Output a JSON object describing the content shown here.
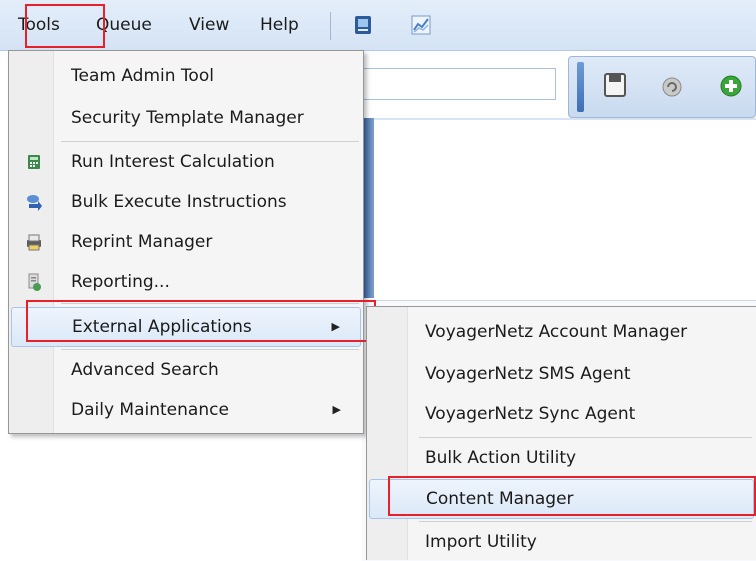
{
  "menubar": {
    "items": [
      {
        "label": "Tools"
      },
      {
        "label": "Queue"
      },
      {
        "label": "View"
      },
      {
        "label": "Help"
      }
    ],
    "icons": [
      "report-icon",
      "chart-icon"
    ]
  },
  "toolbar": {
    "icons": [
      "save-icon",
      "refresh-icon",
      "add-icon"
    ],
    "search_value": ""
  },
  "tools_menu": {
    "items": [
      {
        "label": "Team Admin Tool",
        "icon": null
      },
      {
        "label": "Security Template Manager",
        "icon": null
      },
      {
        "label": "Run Interest Calculation",
        "icon": "calculator-icon"
      },
      {
        "label": "Bulk Execute Instructions",
        "icon": "bulk-arrows-icon"
      },
      {
        "label": "Reprint Manager",
        "icon": "printer-icon"
      },
      {
        "label": "Reporting...",
        "icon": "report-doc-icon"
      },
      {
        "label": "External Applications",
        "icon": null,
        "submenu": true,
        "highlighted": true
      },
      {
        "label": "Advanced Search",
        "icon": null
      },
      {
        "label": "Daily Maintenance",
        "icon": null,
        "submenu": true
      }
    ]
  },
  "external_menu": {
    "items": [
      {
        "label": "VoyagerNetz Account Manager"
      },
      {
        "label": "VoyagerNetz SMS Agent"
      },
      {
        "label": "VoyagerNetz Sync Agent"
      },
      {
        "label": "Bulk Action Utility"
      },
      {
        "label": "Content Manager",
        "highlighted": true
      },
      {
        "label": "Import Utility"
      }
    ]
  },
  "colors": {
    "highlight_box": "#e8202a",
    "menubar_bg": "#d4e3f5",
    "menu_bg": "#f5f5f5"
  }
}
